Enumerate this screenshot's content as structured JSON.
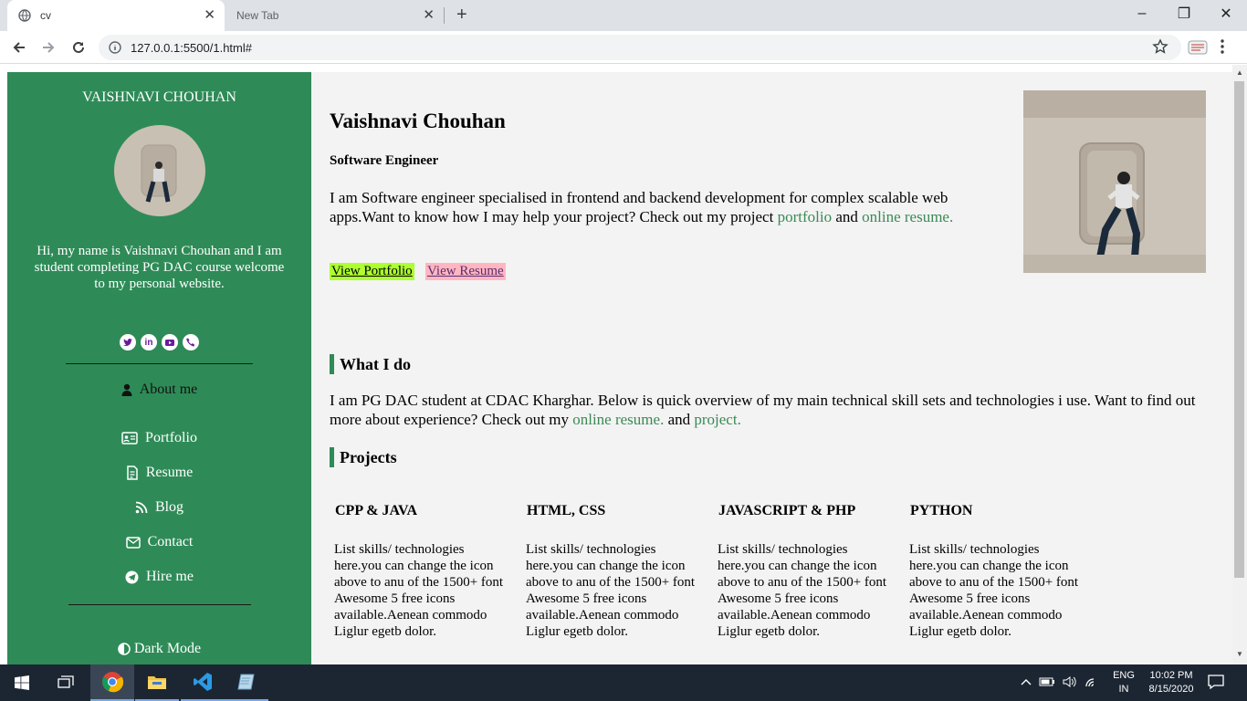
{
  "browser": {
    "tabs": [
      {
        "title": "cv",
        "active": true
      },
      {
        "title": "New Tab",
        "active": false
      }
    ],
    "new_tab": "+",
    "close_glyph": "✕",
    "url": "127.0.0.1:5500/1.html#",
    "window_controls": {
      "minimize": "–",
      "maximize": "❐",
      "close": "✕"
    }
  },
  "sidebar": {
    "name": "VAISHNAVI CHOUHAN",
    "bio": "Hi, my name is Vaishnavi Chouhan and I am student completing PG DAC course welcome to my personal website.",
    "social_icons": [
      "twitter-icon",
      "linkedin-icon",
      "youtube-icon",
      "phone-icon"
    ],
    "nav": [
      {
        "label": "About me",
        "icon": "user-icon"
      },
      {
        "label": "Portfolio",
        "icon": "id-card-icon"
      },
      {
        "label": "Resume",
        "icon": "file-icon"
      },
      {
        "label": "Blog",
        "icon": "rss-icon"
      },
      {
        "label": "Contact",
        "icon": "envelope-icon"
      },
      {
        "label": "Hire me",
        "icon": "paper-plane-icon"
      }
    ],
    "dark_mode": "Dark Mode"
  },
  "main": {
    "name": "Vaishnavi Chouhan",
    "role": "Software Engineer",
    "intro_text": "I am Software engineer specialised in frontend and backend development for complex scalable web apps.Want to know how I may help your project? Check out my project ",
    "intro_link1": "portfolio",
    "intro_and": " and ",
    "intro_link2": "online resume.",
    "btn_portfolio": "View Portfolio",
    "btn_resume": "View Resume",
    "what_i_do_heading": "What I do",
    "what_i_do_text": "I am PG DAC student at CDAC Kharghar. Below is quick overview of my main technical skill sets and technologies i use. Want to find out more about experience? Check out my ",
    "what_i_do_link1": "online resume.",
    "what_i_do_and": " and ",
    "what_i_do_link2": "project.",
    "projects_heading": "Projects",
    "projects": [
      {
        "title": "CPP & JAVA",
        "text": "List skills/ technologies here.you can change the icon above to anu of the 1500+ font Awesome 5 free icons available.Aenean commodo Liglur egetb dolor."
      },
      {
        "title": "HTML, CSS",
        "text": "List skills/ technologies here.you can change the icon above to anu of the 1500+ font Awesome 5 free icons available.Aenean commodo Liglur egetb dolor."
      },
      {
        "title": "JAVASCRIPT & PHP",
        "text": "List skills/ technologies here.you can change the icon above to anu of the 1500+ font Awesome 5 free icons available.Aenean commodo Liglur egetb dolor."
      },
      {
        "title": "PYTHON",
        "text": "List skills/ technologies here.you can change the icon above to anu of the 1500+ font Awesome 5 free icons available.Aenean commodo Liglur egetb dolor."
      }
    ]
  },
  "taskbar": {
    "apps": [
      "windows-start-icon",
      "task-view-icon",
      "chrome-icon",
      "file-explorer-icon",
      "vscode-icon",
      "notepad-icon"
    ],
    "lang_line1": "ENG",
    "lang_line2": "IN",
    "time": "10:02 PM",
    "date": "8/15/2020"
  },
  "colors": {
    "sidebar_bg": "#2e8b57",
    "link": "#3a8a55",
    "portfolio_btn": "#adff2f",
    "resume_btn": "#ffb6c1"
  }
}
